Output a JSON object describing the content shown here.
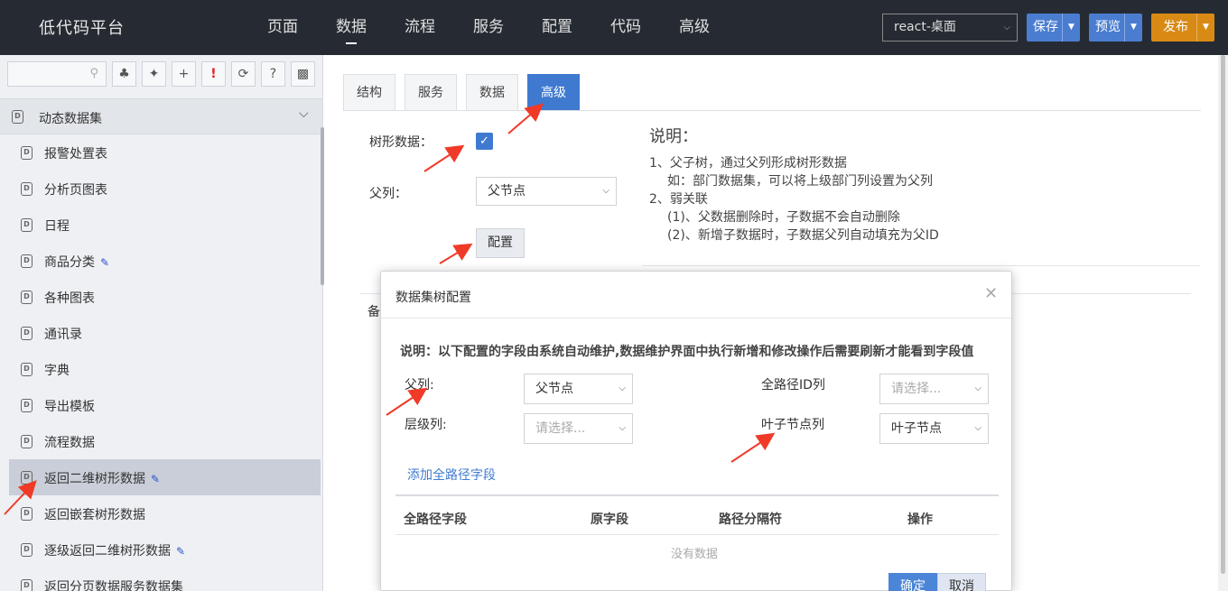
{
  "brand": "低代码平台",
  "nav": [
    "页面",
    "数据",
    "流程",
    "服务",
    "配置",
    "代码",
    "高级"
  ],
  "nav_active_index": 1,
  "env_select": "react-桌面",
  "toolbar": {
    "save": "保存",
    "preview": "预览",
    "publish": "发布"
  },
  "sidebar": {
    "section_title": "动态数据集",
    "items": [
      {
        "label": "报警处置表",
        "edit": false
      },
      {
        "label": "分析页图表",
        "edit": false
      },
      {
        "label": "日程",
        "edit": false
      },
      {
        "label": "商品分类",
        "edit": true
      },
      {
        "label": "各种图表",
        "edit": false
      },
      {
        "label": "通讯录",
        "edit": false
      },
      {
        "label": "字典",
        "edit": false
      },
      {
        "label": "导出模板",
        "edit": false
      },
      {
        "label": "流程数据",
        "edit": false
      },
      {
        "label": "返回二维树形数据",
        "edit": true,
        "selected": true
      },
      {
        "label": "返回嵌套树形数据",
        "edit": false
      },
      {
        "label": "逐级返回二维树形数据",
        "edit": true
      },
      {
        "label": "返回分页数据服务数据集",
        "edit": false
      }
    ]
  },
  "tabs": [
    "结构",
    "服务",
    "数据",
    "高级"
  ],
  "tab_active_index": 3,
  "form": {
    "tree_label": "树形数据：",
    "tree_checked": true,
    "parent_label": "父列：",
    "parent_value": "父节点",
    "config_button": "配置",
    "behind_label": "备"
  },
  "description": {
    "title": "说明：",
    "lines": [
      {
        "text": "1、父子树，通过父列形成树形数据",
        "indent": false
      },
      {
        "text": "如：部门数据集，可以将上级部门列设置为父列",
        "indent": true
      },
      {
        "text": "2、弱关联",
        "indent": false
      },
      {
        "text": "(1)、父数据删除时，子数据不会自动删除",
        "indent": true
      },
      {
        "text": "(2)、新增子数据时，子数据父列自动填充为父ID",
        "indent": true
      }
    ]
  },
  "modal": {
    "title": "数据集树配置",
    "note": "说明：以下配置的字段由系统自动维护,数据维护界面中执行新增和修改操作后需要刷新才能看到字段值",
    "parent_label": "父列:",
    "parent_value": "父节点",
    "fullpath_label": "全路径ID列",
    "fullpath_placeholder": "请选择...",
    "level_label": "层级列:",
    "level_placeholder": "请选择...",
    "leaf_label": "叶子节点列",
    "leaf_value": "叶子节点",
    "add_link": "添加全路径字段",
    "columns": [
      "全路径字段",
      "原字段",
      "路径分隔符",
      "操作"
    ],
    "empty": "没有数据",
    "ok": "确定",
    "cancel": "取消"
  },
  "colors": {
    "topbar": "#262b33",
    "accent": "#3f7ad0",
    "publish": "#d88a15",
    "arrow": "#f03a28"
  }
}
